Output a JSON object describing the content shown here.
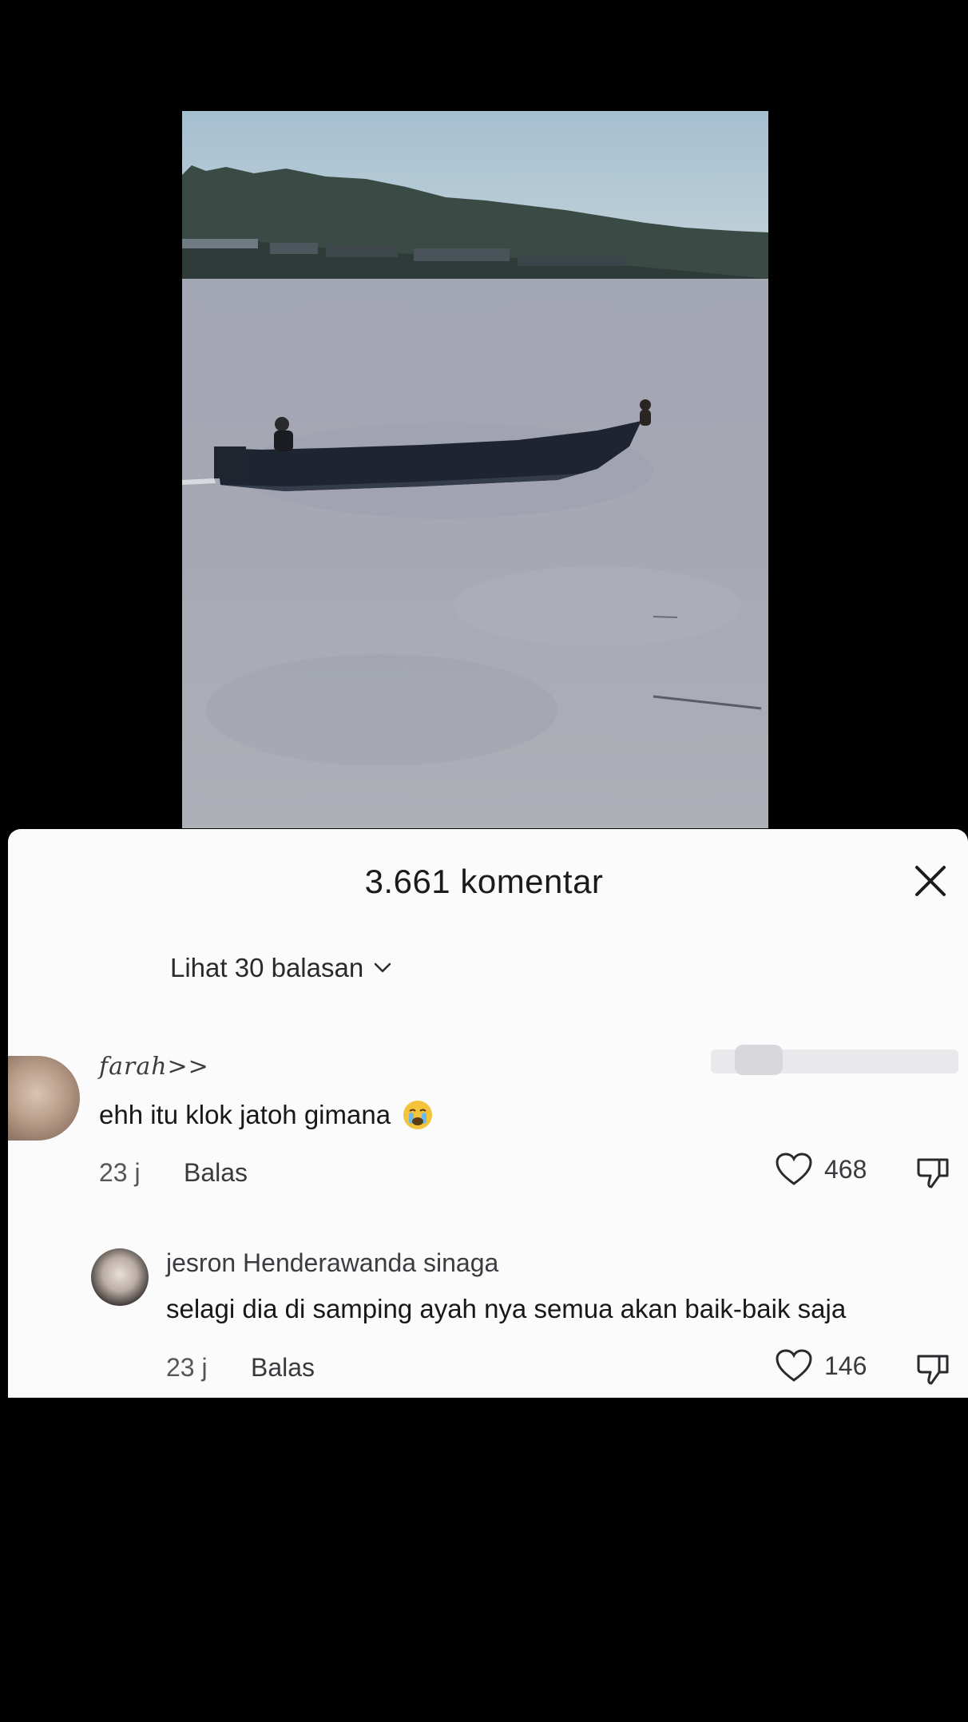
{
  "sheet": {
    "title": "3.661 komentar",
    "close_icon": "close-icon",
    "view_replies": "Lihat 30 balasan"
  },
  "comments": [
    {
      "username": "farah>>",
      "text": "ehh itu klok jatoh gimana",
      "emoji": "crying-face-emoji",
      "time": "23 j",
      "reply_label": "Balas",
      "likes": "468"
    },
    {
      "username": "jesron Henderawanda sinaga",
      "text": "selagi dia di samping ayah nya semua akan baik-baik saja",
      "time": "23 j",
      "reply_label": "Balas",
      "likes": "146"
    }
  ],
  "colors": {
    "background": "#000000",
    "sheet": "#fbfbfc",
    "text": "#18181a",
    "muted": "#55555a"
  }
}
